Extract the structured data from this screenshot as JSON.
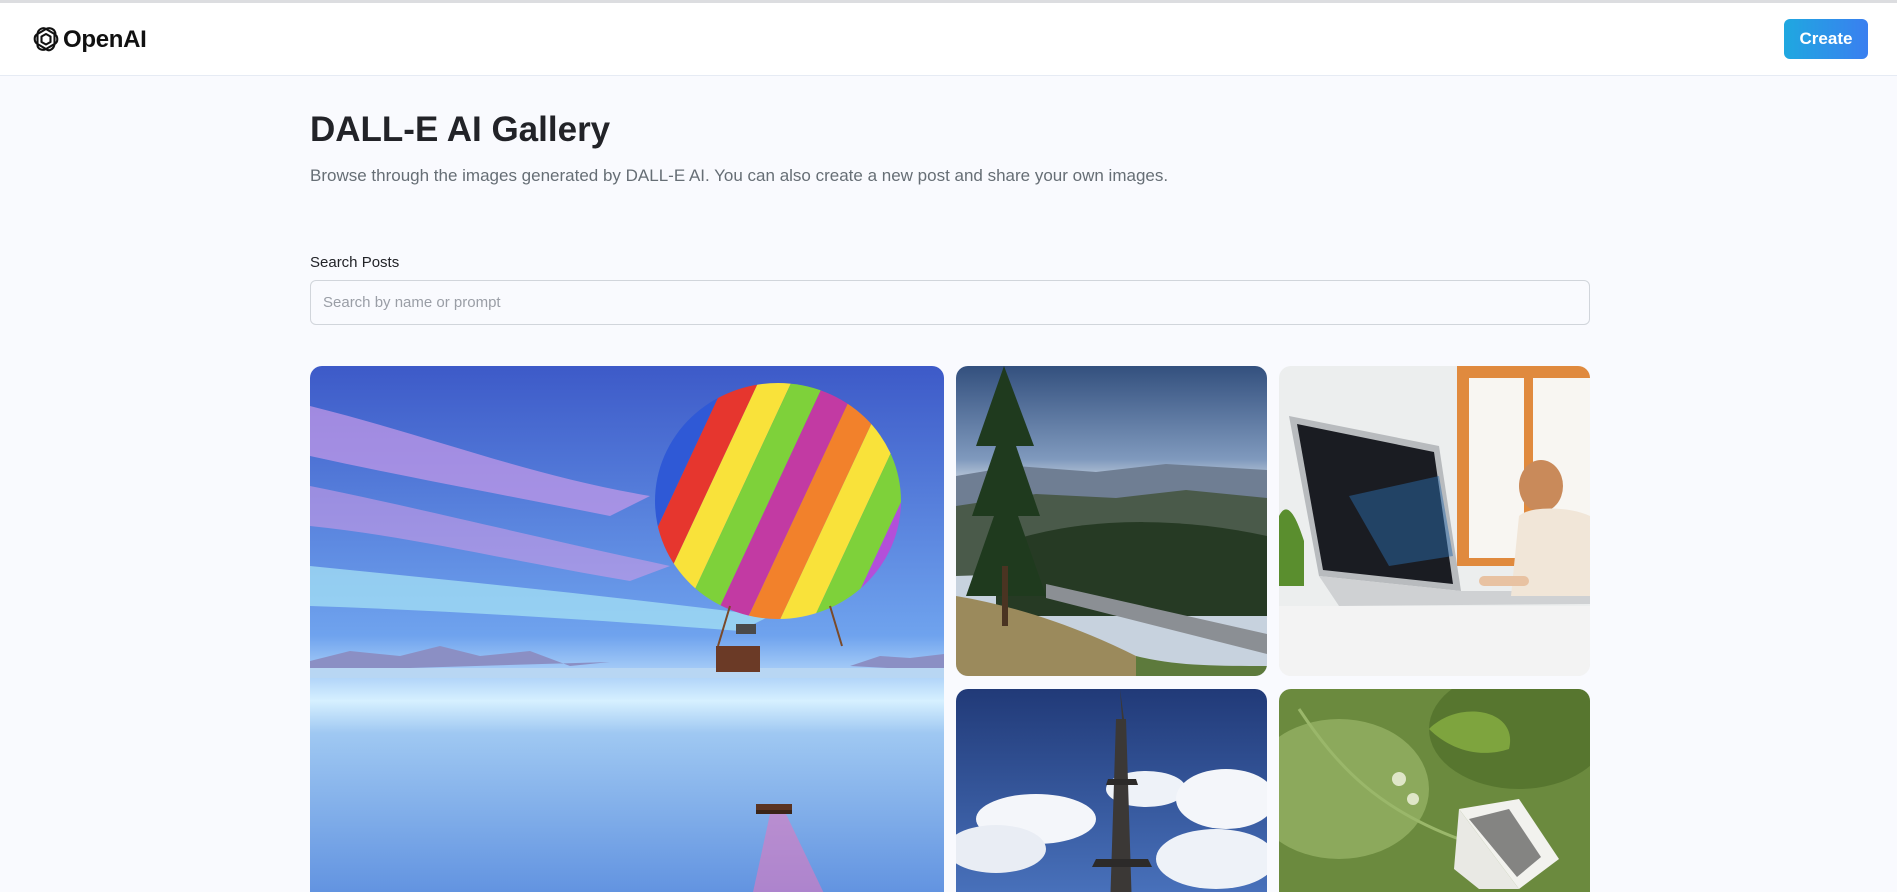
{
  "header": {
    "brand": "OpenAI",
    "create_label": "Create",
    "accent_gradient": [
      "#1fa8e0",
      "#3a7ff0"
    ]
  },
  "main": {
    "title": "DALL-E AI Gallery",
    "description": "Browse through the images generated by DALL-E AI. You can also create a new post and share your own images.",
    "search": {
      "label": "Search Posts",
      "placeholder": "Search by name or prompt",
      "value": ""
    },
    "gallery": [
      {
        "subject": "rainbow hot air balloon over lake"
      },
      {
        "subject": "pine forest mountain valley"
      },
      {
        "subject": "person working at laptop"
      },
      {
        "subject": "eiffel tower with clouds"
      },
      {
        "subject": "butterfly on green plant"
      }
    ]
  },
  "colors": {
    "background": "#f9fafe",
    "title": "#222328",
    "description": "#666e75"
  }
}
